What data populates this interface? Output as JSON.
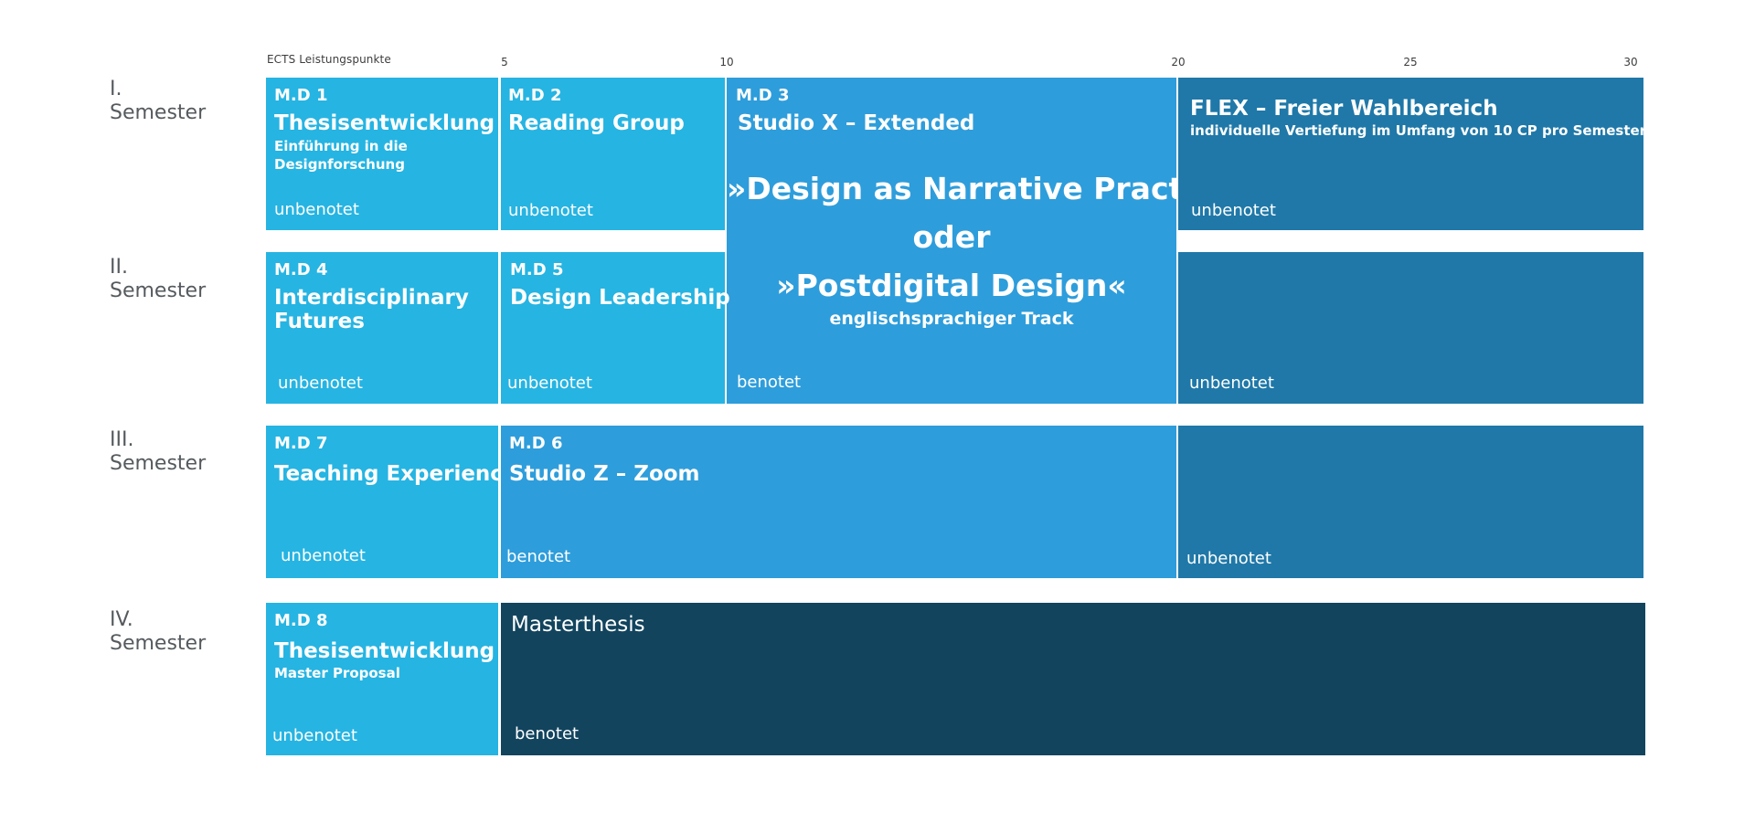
{
  "axis": {
    "label": "ECTS Leistungspunkte",
    "ticks": [
      "5",
      "10",
      "20",
      "25",
      "30"
    ]
  },
  "semesters": [
    {
      "num": "I.",
      "word": "Semester"
    },
    {
      "num": "II.",
      "word": "Semester"
    },
    {
      "num": "III.",
      "word": "Semester"
    },
    {
      "num": "IV.",
      "word": "Semester"
    }
  ],
  "modules": {
    "md1": {
      "code": "M.D 1",
      "title": "Thesisentwicklung I",
      "sub": "Einführung in die Designforschung",
      "grade": "unbenotet"
    },
    "md2": {
      "code": "M.D 2",
      "title": "Reading Group",
      "grade": "unbenotet"
    },
    "md3": {
      "code": "M.D 3",
      "title": "Studio X – Extended",
      "line1": "»Design as Narrative Practice«",
      "line2": "oder",
      "line3": "»Postdigital Design«",
      "track": "englischsprachiger Track",
      "grade": "benotet"
    },
    "flex": {
      "title": "FLEX – Freier Wahlbereich",
      "sub": "individuelle Vertiefung im Umfang von 10 CP pro Semester.",
      "grade": "unbenotet"
    },
    "md4": {
      "code": "M.D 4",
      "title1": "Interdisciplinary",
      "title2": "Futures",
      "grade": "unbenotet"
    },
    "md5": {
      "code": "M.D 5",
      "title": "Design Leadership",
      "grade": "unbenotet"
    },
    "flex2": {
      "grade": "unbenotet"
    },
    "md7": {
      "code": "M.D 7",
      "title": "Teaching Experience",
      "grade": "unbenotet"
    },
    "md6": {
      "code": "M.D 6",
      "title": "Studio Z – Zoom",
      "grade": "benotet"
    },
    "flex3": {
      "grade": "unbenotet"
    },
    "md8": {
      "code": "M.D 8",
      "title": "Thesisentwicklung II",
      "sub": "Master Proposal",
      "grade": "unbenotet"
    },
    "thesis": {
      "title": "Masterthesis",
      "grade": "benotet"
    }
  },
  "colors": {
    "module_light": "#26b4e2",
    "studio": "#2e9ddb",
    "flex": "#1f78a8",
    "thesis": "#12445e"
  }
}
